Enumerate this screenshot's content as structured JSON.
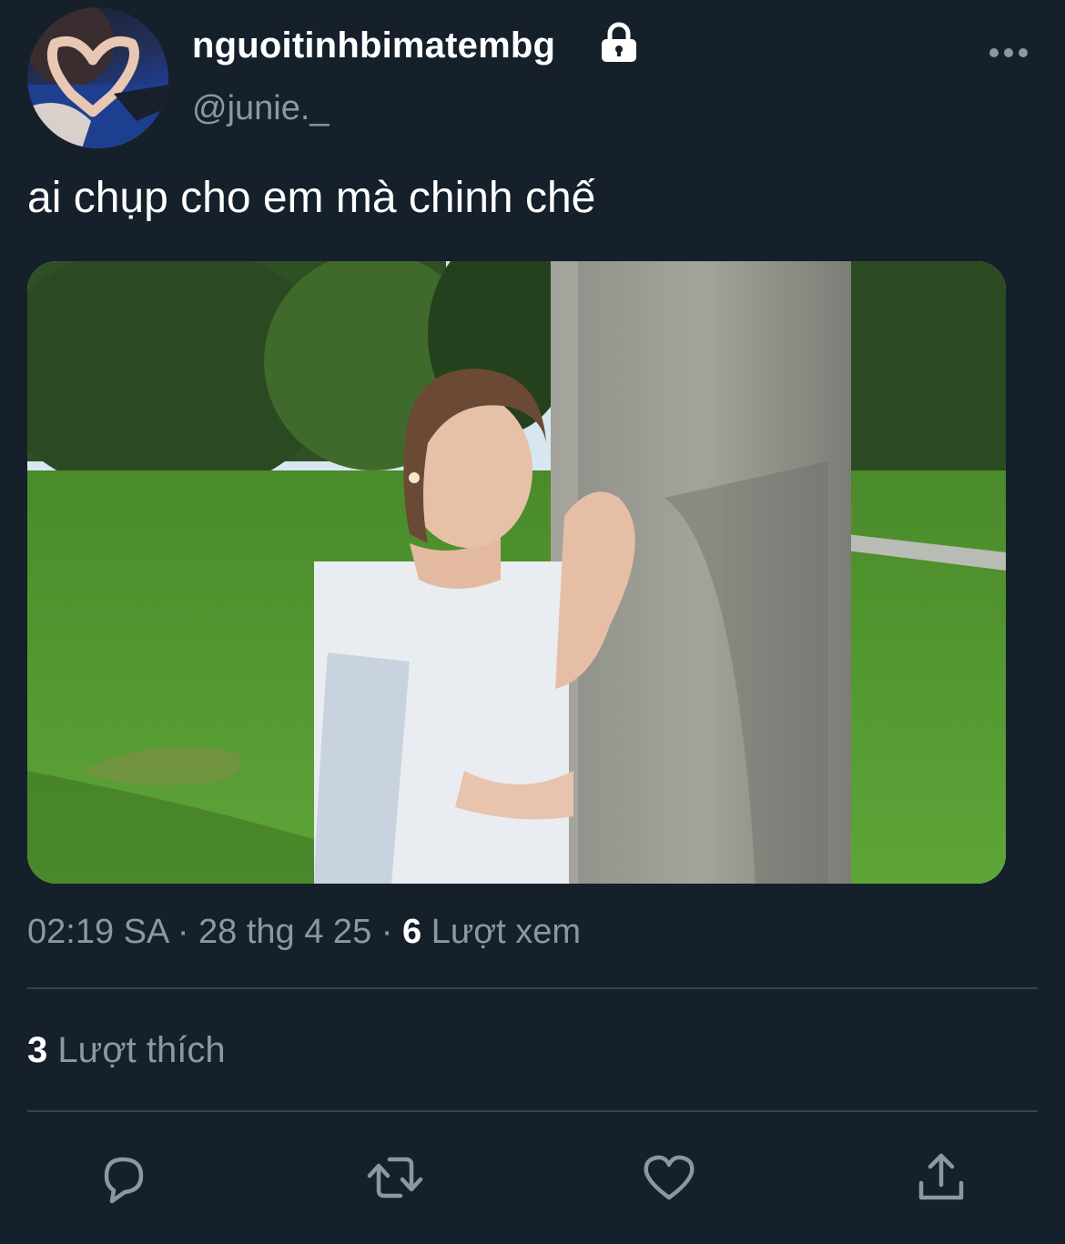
{
  "author": {
    "display_name": "nguoitinhbimatembg",
    "handle": "@junie._",
    "lock_icon": "lock-icon",
    "avatar_icon": "avatar-heart-hands-photo"
  },
  "tweet": {
    "text": "ai chụp cho em mà chinh chế",
    "media_alt": "photo-person-hugging-stone-pillar-in-park"
  },
  "meta": {
    "time": "02:19 SA",
    "separator": "·",
    "date": "28 thg 4 25",
    "views_count": "6",
    "views_label": "Lượt xem"
  },
  "stats": {
    "likes_count": "3",
    "likes_label": "Lượt thích"
  },
  "actions": [
    {
      "name": "reply",
      "icon": "reply-icon"
    },
    {
      "name": "retweet",
      "icon": "retweet-icon"
    },
    {
      "name": "like",
      "icon": "heart-icon"
    },
    {
      "name": "share",
      "icon": "share-icon"
    }
  ],
  "colors": {
    "background": "#15202b",
    "primary_text": "#ffffff",
    "secondary_text": "#8899a6",
    "divider": "#38444d"
  }
}
